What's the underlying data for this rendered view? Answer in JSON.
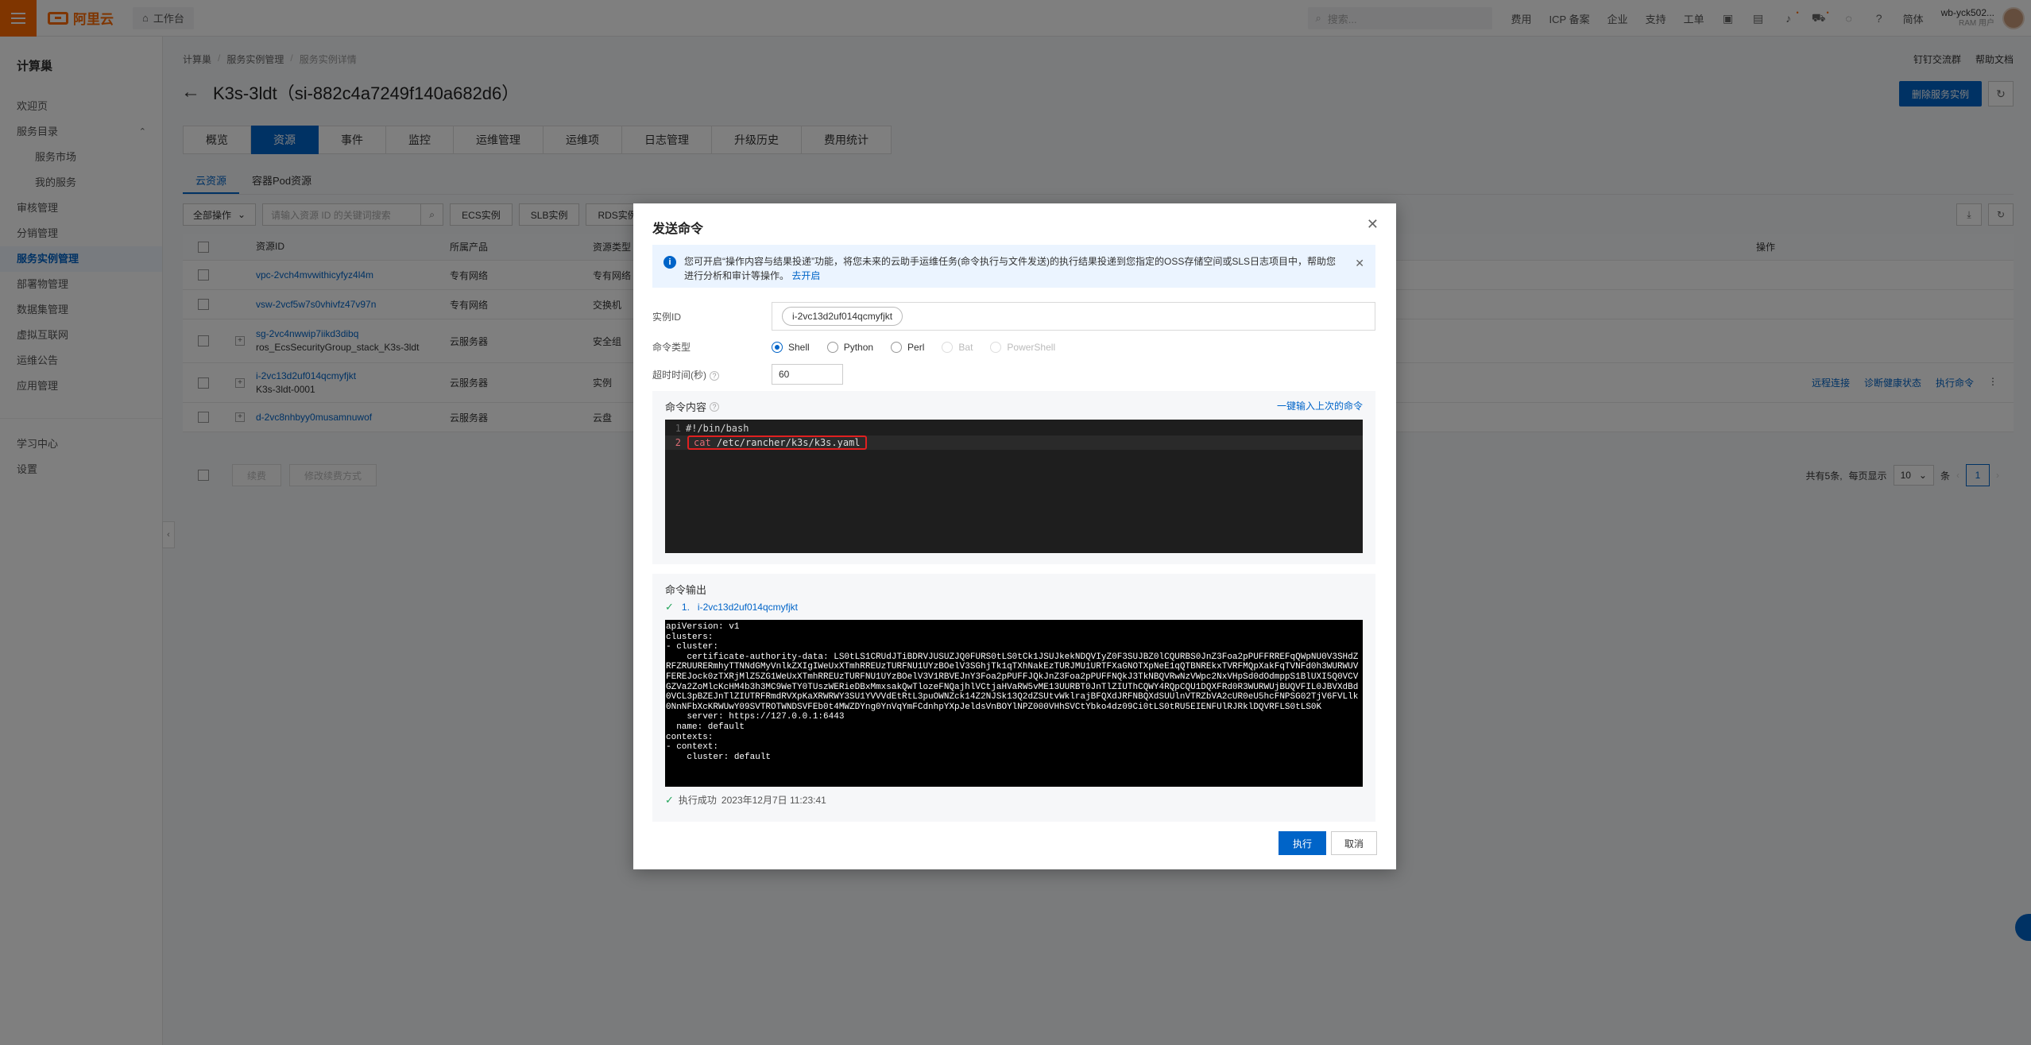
{
  "topbar": {
    "logo_text": "阿里云",
    "workbench_label": "工作台",
    "search_placeholder": "搜索...",
    "links": [
      "费用",
      "ICP 备案",
      "企业",
      "支持",
      "工单"
    ],
    "lang_label": "简体",
    "user_name": "wb-yck502...",
    "user_role": "RAM 用户"
  },
  "sidebar": {
    "title": "计算巢",
    "items": [
      {
        "label": "欢迎页",
        "type": "item"
      },
      {
        "label": "服务目录",
        "type": "group"
      },
      {
        "label": "服务市场",
        "type": "sub"
      },
      {
        "label": "我的服务",
        "type": "sub"
      },
      {
        "label": "审核管理",
        "type": "item"
      },
      {
        "label": "分销管理",
        "type": "item"
      },
      {
        "label": "服务实例管理",
        "type": "active"
      },
      {
        "label": "部署物管理",
        "type": "item"
      },
      {
        "label": "数据集管理",
        "type": "item"
      },
      {
        "label": "虚拟互联网",
        "type": "item"
      },
      {
        "label": "运维公告",
        "type": "item"
      },
      {
        "label": "应用管理",
        "type": "item"
      }
    ],
    "bottom_items": [
      "学习中心",
      "设置"
    ]
  },
  "main": {
    "breadcrumb": [
      "计算巢",
      "服务实例管理",
      "服务实例详情"
    ],
    "top_links": [
      "钉钉交流群",
      "帮助文档"
    ],
    "title": "K3s-3ldt（si-882c4a7249f140a682d6）",
    "delete_button": "删除服务实例",
    "tabs": [
      "概览",
      "资源",
      "事件",
      "监控",
      "运维管理",
      "运维项",
      "日志管理",
      "升级历史",
      "费用统计"
    ],
    "active_tab": "资源",
    "subtabs": [
      "云资源",
      "容器Pod资源"
    ],
    "toolbar": {
      "all_ops": "全部操作",
      "search_placeholder": "请输入资源 ID 的关键词搜索",
      "filters": [
        "ECS实例",
        "SLB实例",
        "RDS实例"
      ]
    },
    "table": {
      "headers": [
        "资源ID",
        "所属产品",
        "资源类型",
        "操作"
      ],
      "rows": [
        {
          "id": "vpc-2vch4mvwithicyfyz4l4m",
          "id2": "",
          "product": "专有网络",
          "type": "专有网络",
          "expand": false
        },
        {
          "id": "vsw-2vcf5w7s0vhivfz47v97n",
          "id2": "",
          "product": "专有网络",
          "type": "交换机",
          "expand": false
        },
        {
          "id": "sg-2vc4nwwip7iikd3dibq",
          "id2": "ros_EcsSecurityGroup_stack_K3s-3ldt",
          "product": "云服务器",
          "type": "安全组",
          "expand": true
        },
        {
          "id": "i-2vc13d2uf014qcmyfjkt",
          "id2": "K3s-3ldt-0001",
          "product": "云服务器",
          "type": "实例",
          "expand": true,
          "ops": [
            "远程连接",
            "诊断健康状态",
            "执行命令"
          ]
        },
        {
          "id": "d-2vc8nhbyy0musamnuwof",
          "id2": "",
          "product": "云服务器",
          "type": "云盘",
          "expand": true
        }
      ]
    },
    "bottom_actions": [
      "续费",
      "修改续费方式"
    ],
    "pagination": {
      "total_text": "共有5条,",
      "per_page_label": "每页显示",
      "per_page": "10",
      "unit": "条",
      "current": "1"
    }
  },
  "dialog": {
    "title": "发送命令",
    "info_text": "您可开启“操作内容与结果投递”功能，将您未来的云助手运维任务(命令执行与文件发送)的执行结果投递到您指定的OSS存储空间或SLS日志项目中，帮助您进行分析和审计等操作。",
    "info_link": "去开启",
    "instance_label": "实例ID",
    "instance_value": "i-2vc13d2uf014qcmyfjkt",
    "cmd_type_label": "命令类型",
    "cmd_types": [
      {
        "label": "Shell",
        "state": "checked"
      },
      {
        "label": "Python",
        "state": "normal"
      },
      {
        "label": "Perl",
        "state": "normal"
      },
      {
        "label": "Bat",
        "state": "disabled"
      },
      {
        "label": "PowerShell",
        "state": "disabled"
      }
    ],
    "timeout_label": "超时时间(秒)",
    "timeout_value": "60",
    "content_title": "命令内容",
    "reuse_link": "一键输入上次的命令",
    "code_lines": [
      {
        "num": "1",
        "text": "#!/bin/bash"
      },
      {
        "num": "2",
        "kw": "cat",
        "arg": " /etc/rancher/k3s/k3s.yaml"
      }
    ],
    "output_title": "命令输出",
    "output_item_index": "1.",
    "output_instance": "i-2vc13d2uf014qcmyfjkt",
    "terminal": {
      "head": "apiVersion: v1\nclusters:\n- cluster:",
      "cert_prefix": "    certificate-authority-data: ",
      "cert_blob": "LS0tLS1CRUdJTiBDRVJUSUZJQ0FURS0tLS0tCk1JSUJkekNDQVIyZ0F3SUJBZ0lCQURBS0JnZ3Foa2pPUFFRREFqQWpNU0V3SHdZRFZRUURERmhyTTNNdGMyVnlkZXIgIWeUxXTmhRREUzTURFNU1UYzBOelV3SGhjTk1qTXhNakEzTURJMU1URTFXaGNOTXpNeE1qQTBNREkxTVRFMQpXakFqTVNFd0h3WURWUVFEREJock0zTXRjMlZ5ZG1WeUxXTmhRREUzTURFNU1UYzBOelV3V1RBVEJnY3Foa2pPUFFJQkJnZ3Foa2pPUFFNQkJ3TkNBQVRwNzVWpc2NxVHpSd0dOdmppS1BlUXI5Q0VCVGZVa2ZoMlcKcHM4b3h3MC9WeTY0TUszWERieDBxMmxsakQwTlozeFNQajhlVCtjaHVaRW5vME13UURBT0JnTlZIUThCQWY4RQpCQU1DQXFRd0R3WURWUjBUQVFIL0JBVXdBd0VCL3pBZEJnTlZIUTRFRmdRVXpKaXRWRWY3SU1YVVVdEtRtL3puOWNZck14Z2NJSk13Q2dZSUtvWklrajBFQXdJRFNBQXdSUUlnVTRZbVA2cUR0eU5hcFNPSG02TjV6FVLlk0NnNFbXcKRWUwY09SVTROTWNDSVFEb0t4MWZDYng0YnVqYmFCdnhpYXpJeldsVnBOYlNPZ000VHhSVCtYbko4dz09Ci0tLS0tRU5EIENFUlRJRklDQVRFLS0tLS0K",
      "tail": "    server: https://127.0.0.1:6443\n  name: default\ncontexts:\n- context:\n    cluster: default"
    },
    "exec_status": "执行成功",
    "exec_time": "2023年12月7日 11:23:41",
    "execute_button": "执行",
    "cancel_button": "取消"
  },
  "colors": {
    "brand": "#ff6a00",
    "primary": "#0064c8",
    "success": "#23a55a",
    "highlight": "#e02020"
  }
}
